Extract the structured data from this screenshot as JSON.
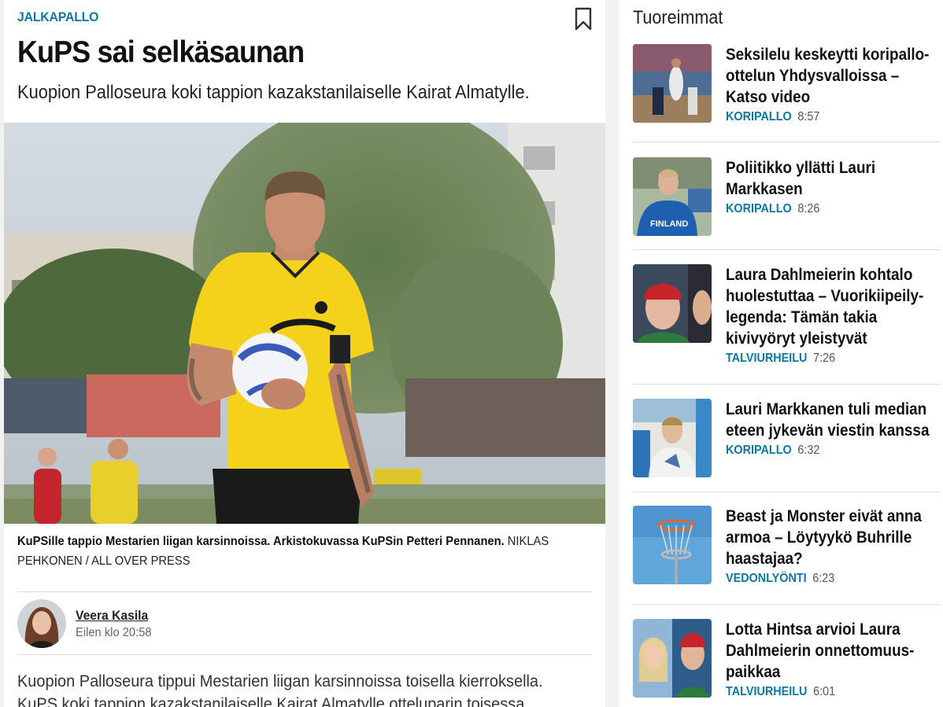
{
  "article": {
    "category": "JALKAPALLO",
    "headline": "KuPS sai selkäsaunan",
    "lead": "Kuopion Palloseura koki tappion kazakstanilaiselle Kairat Almatylle.",
    "photo_icon": "football-player-photo",
    "caption_bold": "KuPSille tappio Mestarien liigan karsinnoissa. Arkistokuvassa KuPSin Petteri Pennanen.",
    "caption_credit": "NIKLAS PEHKONEN / ALL OVER PRESS",
    "author_name": "Veera Kasila",
    "author_time": "Eilen klo 20:58",
    "body": "Kuopion Palloseura tippui Mestarien liigan karsinnoissa toisella kierroksella. KuPS koki tappion kazakstanilaiselle Kairat Almatylle otteluparin toisessa osaottelussa."
  },
  "sidebar": {
    "title": "Tuoreimmat",
    "items": [
      {
        "title": "Seksilelu keskeytti koripallo-ottelun Yhdysvalloissa – Katso video",
        "category": "KORIPALLO",
        "time": "8:57",
        "thumb": "basketball-game"
      },
      {
        "title": "Poliitikko yllätti Lauri Markkasen",
        "category": "KORIPALLO",
        "time": "8:26",
        "thumb": "finland-player"
      },
      {
        "title": "Laura Dahlmeierin kohtalo huolestuttaa – Vuorikiipeily-legenda: Tämän takia kivivyöryt yleistyvät",
        "category": "TALVIURHEILU",
        "time": "7:26",
        "thumb": "biathlete-portrait"
      },
      {
        "title": "Lauri Markkanen tuli median eteen jykevän viestin kanssa",
        "category": "KORIPALLO",
        "time": "6:32",
        "thumb": "press-conference"
      },
      {
        "title": "Beast ja Monster eivät anna armoa – Löytyykö Buhrille haastajaa?",
        "category": "VEDONLYÖNTI",
        "time": "6:23",
        "thumb": "disc-golf-basket"
      },
      {
        "title": "Lotta Hintsa arvioi Laura Dahlmeierin onnettomuus-paikkaa",
        "category": "TALVIURHEILU",
        "time": "6:01",
        "thumb": "two-women"
      }
    ]
  },
  "colors": {
    "accent": "#0b78a6",
    "background": "#f2f2f2",
    "jersey": "#f4d21c"
  }
}
